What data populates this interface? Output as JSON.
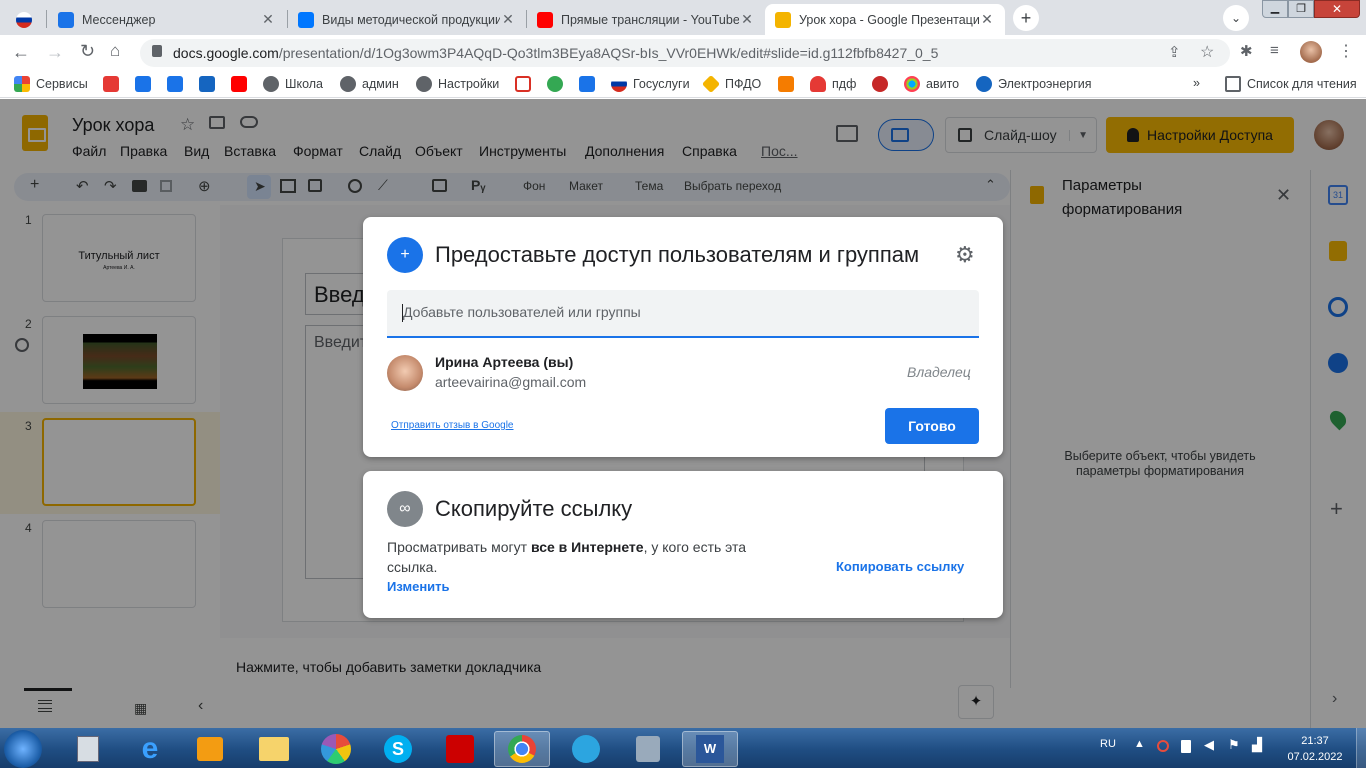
{
  "tabs": [
    {
      "title": "",
      "favicon_color": "#d52b1e"
    },
    {
      "title": "Мессенджер",
      "favicon_color": "#1a73e8"
    },
    {
      "title": "Виды методической продукции",
      "favicon_color": "#0077ff"
    },
    {
      "title": "Прямые трансляции - YouTube S",
      "favicon_color": "#ff0000"
    },
    {
      "title": "Урок хора - Google Презентаци",
      "favicon_color": "#f4b400"
    }
  ],
  "address": {
    "url_domain": "docs.google.com",
    "url_path": "/presentation/d/1Og3owm3P4AQqD-Qo3tlm3BEya8AQSr-bIs_VVr0EHWk/edit#slide=id.g112fbfb8427_0_5"
  },
  "bookmarks": [
    {
      "label": "Сервисы",
      "color": "#4285f4"
    },
    {
      "label": "",
      "color": "#e53935"
    },
    {
      "label": "",
      "color": "#1a73e8"
    },
    {
      "label": "",
      "color": "#1a73e8"
    },
    {
      "label": "",
      "color": "#1565c0"
    },
    {
      "label": "",
      "color": "#ff0000"
    },
    {
      "label": "Школа",
      "color": "#5f6368"
    },
    {
      "label": "админ",
      "color": "#5f6368"
    },
    {
      "label": "Настройки",
      "color": "#5f6368"
    },
    {
      "label": "",
      "color": "#d93025"
    },
    {
      "label": "",
      "color": "#34a853"
    },
    {
      "label": "",
      "color": "#1a73e8"
    },
    {
      "label": "Госуслуги",
      "color": "#d52b1e"
    },
    {
      "label": "ПФДО",
      "color": "#f4b400"
    },
    {
      "label": "",
      "color": "#f57c00"
    },
    {
      "label": "пдф",
      "color": "#e53935"
    },
    {
      "label": "",
      "color": "#c62828"
    },
    {
      "label": "авито",
      "color": "#00aaff"
    },
    {
      "label": "Электроэнергия",
      "color": "#1565c0"
    }
  ],
  "bookmarks_more": "»",
  "reading_list": "Список для чтения",
  "docs": {
    "title": "Урок хора",
    "menus": [
      "Файл",
      "Правка",
      "Вид",
      "Вставка",
      "Формат",
      "Слайд",
      "Объект",
      "Инструменты",
      "Дополнения",
      "Справка",
      "Пос..."
    ],
    "slideshow_label": "Слайд-шоу",
    "share_label": "Настройки Доступа",
    "toolbar": {
      "background": "Фон",
      "layout": "Макет",
      "theme": "Тема",
      "transition": "Выбрать переход"
    },
    "slides": [
      {
        "num": "1",
        "title": "Титульный лист",
        "subtitle": "Артеева И. А."
      },
      {
        "num": "2"
      },
      {
        "num": "3"
      },
      {
        "num": "4"
      }
    ],
    "slide_title_partial": "Введ",
    "slide_body_partial": "Введит",
    "notes_placeholder": "Нажмите, чтобы добавить заметки докладчика",
    "panel_title": "Параметры форматирования",
    "panel_hint": "Выберите объект, чтобы увидеть параметры форматирования"
  },
  "share_dialog": {
    "heading": "Предоставьте доступ пользователям и группам",
    "input_placeholder": "Добавьте пользователей или группы",
    "user": {
      "name": "Ирина Артеева (вы)",
      "email": "arteevairina@gmail.com",
      "role": "Владелец"
    },
    "feedback_link": "Отправить отзыв в Google",
    "done_button": "Готово",
    "accent": "#1a73e8"
  },
  "link_card": {
    "heading": "Скопируйте ссылку",
    "text_prefix": "Просматривать могут ",
    "text_bold": "все в Интернете",
    "text_suffix": ", у кого есть эта ссылка.",
    "change_link": "Изменить",
    "copy_link": "Копировать ссылку"
  },
  "taskbar": {
    "lang": "RU",
    "time": "21:37",
    "date": "07.02.2022"
  }
}
